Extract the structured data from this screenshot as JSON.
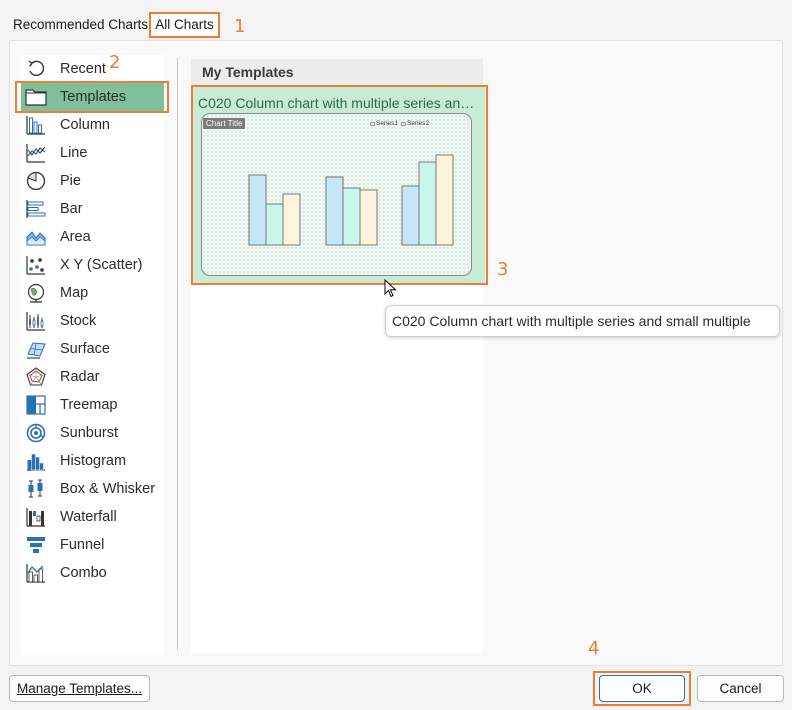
{
  "tabs": {
    "recommended_label": "Recommended Charts",
    "all_charts_label": "All Charts"
  },
  "markers": {
    "m1": "1",
    "m2": "2",
    "m3": "3",
    "m4": "4"
  },
  "sidebar": {
    "items": [
      {
        "label": "Recent",
        "icon": "recent-icon"
      },
      {
        "label": "Templates",
        "icon": "folder-icon",
        "selected": true
      },
      {
        "label": "Column",
        "icon": "column-chart-icon"
      },
      {
        "label": "Line",
        "icon": "line-chart-icon"
      },
      {
        "label": "Pie",
        "icon": "pie-chart-icon"
      },
      {
        "label": "Bar",
        "icon": "bar-chart-icon"
      },
      {
        "label": "Area",
        "icon": "area-chart-icon"
      },
      {
        "label": "X Y (Scatter)",
        "icon": "scatter-chart-icon"
      },
      {
        "label": "Map",
        "icon": "map-chart-icon"
      },
      {
        "label": "Stock",
        "icon": "stock-chart-icon"
      },
      {
        "label": "Surface",
        "icon": "surface-chart-icon"
      },
      {
        "label": "Radar",
        "icon": "radar-chart-icon"
      },
      {
        "label": "Treemap",
        "icon": "treemap-chart-icon"
      },
      {
        "label": "Sunburst",
        "icon": "sunburst-chart-icon"
      },
      {
        "label": "Histogram",
        "icon": "histogram-chart-icon"
      },
      {
        "label": "Box & Whisker",
        "icon": "box-whisker-chart-icon"
      },
      {
        "label": "Waterfall",
        "icon": "waterfall-chart-icon"
      },
      {
        "label": "Funnel",
        "icon": "funnel-chart-icon"
      },
      {
        "label": "Combo",
        "icon": "combo-chart-icon"
      }
    ]
  },
  "content": {
    "header": "My Templates",
    "template": {
      "title": "C020 Column chart with multiple series and small multiple",
      "thumbnail": {
        "chart_title": "Chart Title",
        "legend": [
          "Series1",
          "Series2"
        ]
      }
    }
  },
  "tooltip": "C020 Column chart with multiple series and small multiple",
  "footer": {
    "manage_label": "Manage Templates...",
    "ok_label": "OK",
    "cancel_label": "Cancel"
  },
  "colors": {
    "accent_outline": "#ed7d31",
    "selected_bg": "#7fbf9a",
    "template_card_bg": "#c8ebd6",
    "bar_blue": "#c5e6f7",
    "bar_mint": "#c9f5ea",
    "bar_cream": "#fbf3dc",
    "icon_blue": "#2b6fb7"
  }
}
